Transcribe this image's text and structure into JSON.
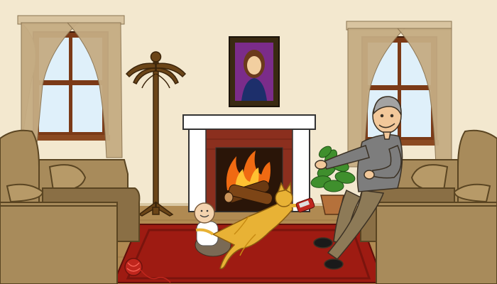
{
  "scene": {
    "kind": "illustrated living room",
    "colors": {
      "wall": "#f3e8cf",
      "floor": "#b08a52",
      "rug": "#9e1b12",
      "rug_inner": "#7a140d",
      "brick": "#8b2f1e",
      "mantel": "#ffffff",
      "curtain": "#c5ac83",
      "window_frame": "#7b3a17",
      "glass": "#dff0fa",
      "armchair": "#a88b5b",
      "armchair_dark": "#8a6f45",
      "coat_rack": "#6b4518",
      "cat": "#e8b235",
      "portrait_frame": "#3a2a12",
      "portrait_bg": "#7b2c8a",
      "plant": "#3f8f2d",
      "pot": "#b5713b",
      "yarn": "#c0261d",
      "sweater": "#7d7d7d",
      "pants": "#8d7a57"
    },
    "icons": [
      "window-left-icon",
      "window-right-icon",
      "portrait-icon",
      "coat-rack-icon",
      "fireplace-icon",
      "armchair-left-icon",
      "armchair-right-icon",
      "plant-icon",
      "yarn-ball-icon",
      "cat-icon",
      "baby-icon",
      "grandpa-icon"
    ]
  }
}
